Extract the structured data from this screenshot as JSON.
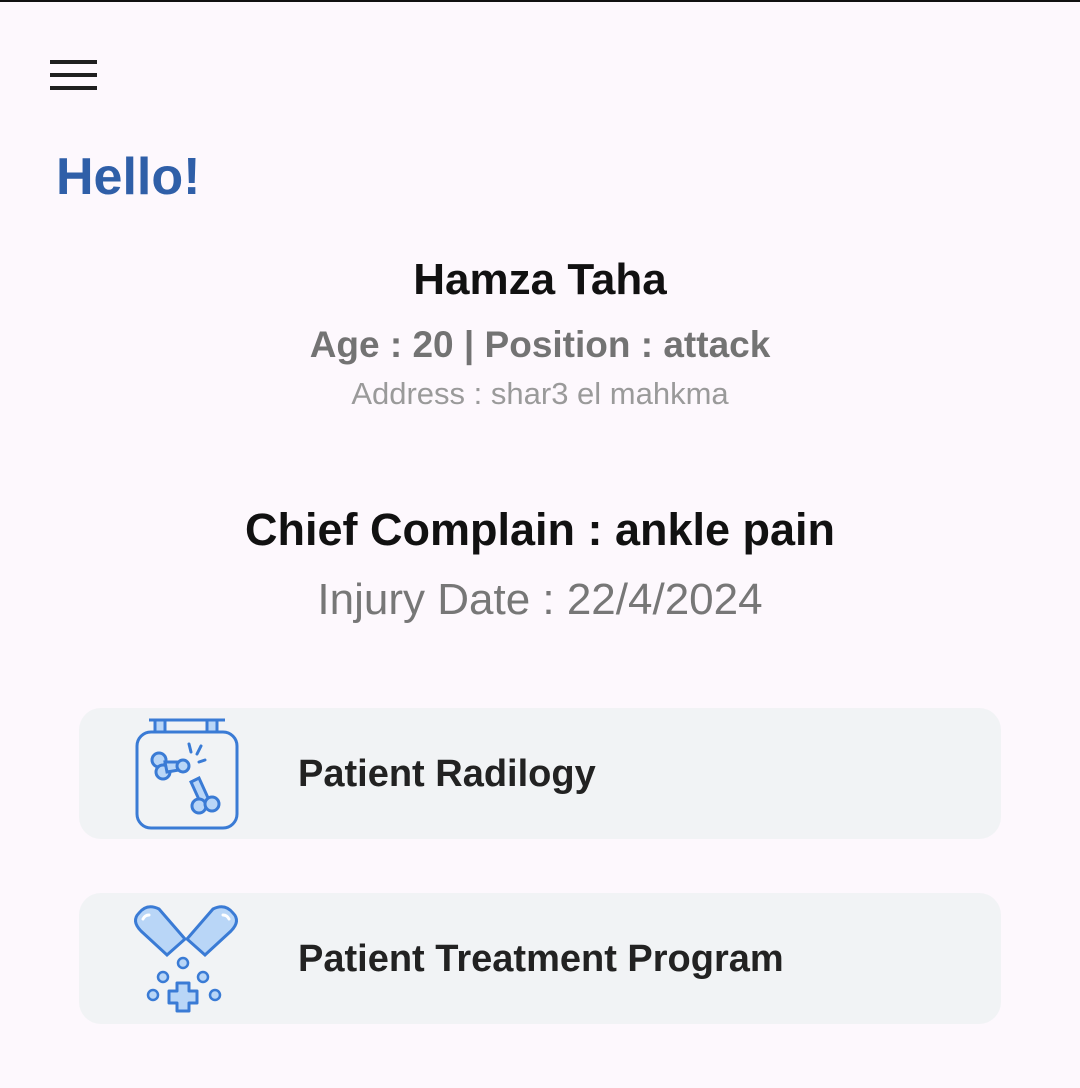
{
  "menu": {
    "icon": "menu-icon"
  },
  "greeting": "Hello!",
  "patient": {
    "name": "Hamza Taha",
    "meta": "Age : 20 |  Position : attack",
    "address": "Address : shar3 el mahkma"
  },
  "complaint": {
    "chief": "Chief Complain : ankle pain",
    "injury_date": "Injury Date : 22/4/2024"
  },
  "cards": [
    {
      "label": "Patient Radilogy",
      "icon": "bone-xray-icon"
    },
    {
      "label": "Patient Treatment Program",
      "icon": "capsule-medication-icon"
    }
  ],
  "colors": {
    "background": "#fdf8fd",
    "greeting": "#2f5fa8",
    "card_bg": "#f1f3f5",
    "icon_stroke": "#3a7bd5",
    "icon_fill": "#b9d6f7"
  }
}
